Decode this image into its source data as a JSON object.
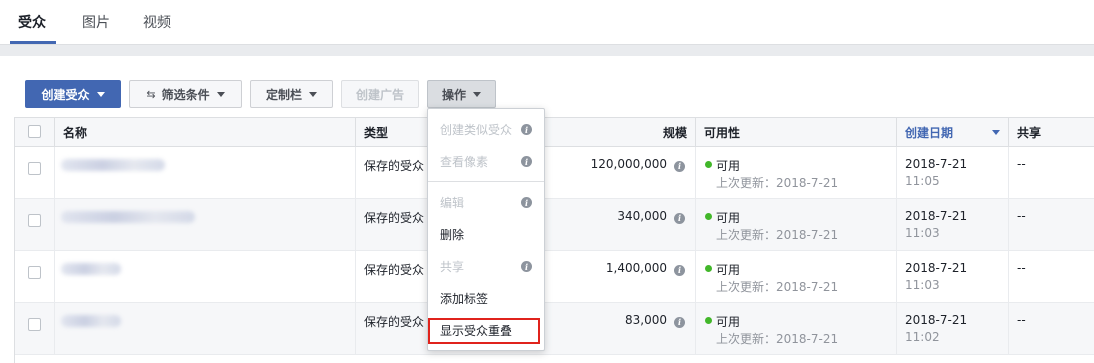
{
  "tabs": [
    {
      "label": "受众"
    },
    {
      "label": "图片"
    },
    {
      "label": "视频"
    }
  ],
  "toolbar": {
    "create_audience": "创建受众",
    "filter": "筛选条件",
    "customize": "定制栏",
    "create_ad": "创建广告",
    "actions": "操作"
  },
  "table": {
    "headers": {
      "name": "名称",
      "type": "类型",
      "size": "规模",
      "availability": "可用性",
      "created": "创建日期",
      "shared": "共享"
    },
    "rows": [
      {
        "type": "保存的受众",
        "size": "120,000,000",
        "status": "可用",
        "updated": "上次更新：2018-7-21",
        "date": "2018-7-21",
        "time": "11:05",
        "shared": "--"
      },
      {
        "type": "保存的受众",
        "size": "340,000",
        "status": "可用",
        "updated": "上次更新：2018-7-21",
        "date": "2018-7-21",
        "time": "11:03",
        "shared": "--"
      },
      {
        "type": "保存的受众",
        "size": "1,400,000",
        "status": "可用",
        "updated": "上次更新：2018-7-21",
        "date": "2018-7-21",
        "time": "11:03",
        "shared": "--"
      },
      {
        "type": "保存的受众",
        "size": "83,000",
        "status": "可用",
        "updated": "上次更新：2018-7-21",
        "date": "2018-7-21",
        "time": "11:02",
        "shared": "--"
      }
    ]
  },
  "menu": {
    "items": [
      {
        "label": "创建类似受众",
        "enabled": false
      },
      {
        "label": "查看像素",
        "enabled": false
      },
      {
        "label": "编辑",
        "enabled": false
      },
      {
        "label": "删除",
        "enabled": true
      },
      {
        "label": "共享",
        "enabled": false
      },
      {
        "label": "添加标签",
        "enabled": true
      },
      {
        "label": "显示受众重叠",
        "enabled": true
      }
    ]
  },
  "colors": {
    "accent": "#4267b2",
    "status_ok": "#42b72a",
    "highlight": "#e0231c"
  },
  "icons": {
    "info": "info-icon",
    "swap": "swap-icon",
    "caret": "caret-down-icon"
  }
}
